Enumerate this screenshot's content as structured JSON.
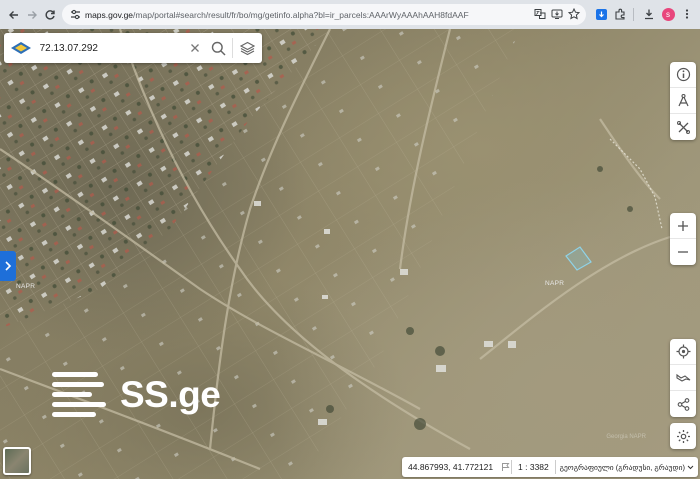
{
  "browser": {
    "url_host": "maps.gov.ge",
    "url_path": "/map/portal#search/result/fr/bo/mg/getinfo.alpha?bl=ir_parcels:AAArWyAAAhAAH8fdAAF",
    "profile_initial": "s",
    "accent_color": "#1a73e8"
  },
  "search": {
    "value": "72.13.07.292",
    "placeholder": ""
  },
  "map": {
    "labels": [
      "NAPR",
      "NAPR"
    ],
    "watermark_text": "SS.ge",
    "faint_watermark": "Georgia NAPR"
  },
  "status": {
    "coords": "44.867993, 41.772121",
    "scale": "1 : 3382",
    "projection": "გეოგრაფიული (გრადუსი, გრაუდი)"
  },
  "icons": {
    "back": "arrow-left-icon",
    "forward": "arrow-right-icon",
    "reload": "reload-icon",
    "site-info": "tune-icon",
    "translate": "translate-icon",
    "install": "install-icon",
    "bookmark": "star-icon",
    "extension": "extension-icon",
    "puzzle": "puzzle-icon",
    "download": "download-icon",
    "menu": "kebab-menu-icon"
  }
}
